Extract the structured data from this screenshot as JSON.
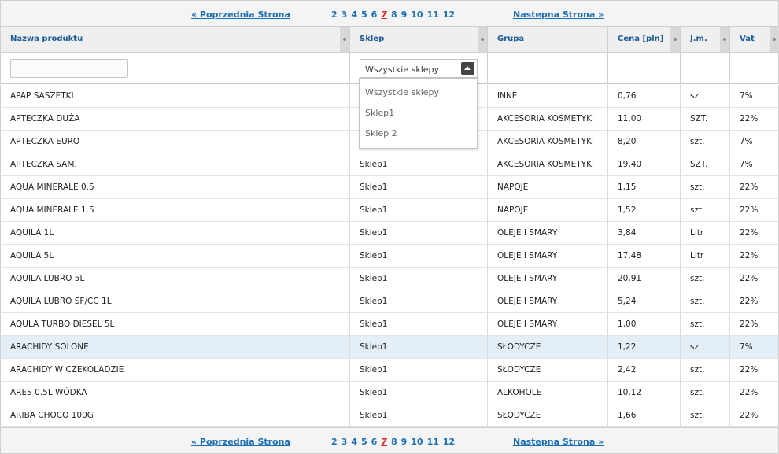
{
  "pager": {
    "prev_label": "« Poprzednia Strona",
    "next_label": "Nastepna Strona »",
    "pages": [
      "2",
      "3",
      "4",
      "5",
      "6",
      "7",
      "8",
      "9",
      "10",
      "11",
      "12"
    ],
    "current": "7"
  },
  "columns": [
    "Nazwa produktu",
    "Sklep",
    "Grupa",
    "Cena [pln]",
    "J.m.",
    "Vat"
  ],
  "filters": {
    "name_value": "",
    "shop_value": "Wszystkie sklepy",
    "shop_options": [
      "Wszystkie sklepy",
      "Sklep1",
      "Sklep 2"
    ]
  },
  "rows": [
    [
      "APAP SASZETKI",
      "",
      "INNE",
      "0,76",
      "szt.",
      "7%"
    ],
    [
      "APTECZKA DUŻA",
      "",
      "AKCESORIA KOSMETYKI",
      "11,00",
      "SZT.",
      "22%"
    ],
    [
      "APTECZKA EURO",
      "",
      "AKCESORIA KOSMETYKI",
      "8,20",
      "szt.",
      "7%"
    ],
    [
      "APTECZKA SAM.",
      "Sklep1",
      "AKCESORIA KOSMETYKI",
      "19,40",
      "SZT.",
      "7%"
    ],
    [
      "AQUA MINERALE 0.5",
      "Sklep1",
      "NAPOJE",
      "1,15",
      "szt.",
      "22%"
    ],
    [
      "AQUA MINERALE 1.5",
      "Sklep1",
      "NAPOJE",
      "1,52",
      "szt.",
      "22%"
    ],
    [
      "AQUILA 1L",
      "Sklep1",
      "OLEJE I SMARY",
      "3,84",
      "Litr",
      "22%"
    ],
    [
      "AQUILA 5L",
      "Sklep1",
      "OLEJE I SMARY",
      "17,48",
      "Litr",
      "22%"
    ],
    [
      "AQUILA LUBRO 5L",
      "Sklep1",
      "OLEJE I SMARY",
      "20,91",
      "szt.",
      "22%"
    ],
    [
      "AQUILA LUBRO SF/CC 1L",
      "Sklep1",
      "OLEJE I SMARY",
      "5,24",
      "szt.",
      "22%"
    ],
    [
      "AQULA TURBO DIESEL 5L",
      "Sklep1",
      "OLEJE I SMARY",
      "1,00",
      "szt.",
      "22%"
    ],
    [
      "ARACHIDY SOLONE",
      "Sklep1",
      "SŁODYCZE",
      "1,22",
      "szt.",
      "7%"
    ],
    [
      "ARACHIDY W CZEKOLADZIE",
      "Sklep1",
      "SŁODYCZE",
      "2,42",
      "szt.",
      "22%"
    ],
    [
      "ARES 0.5L WÓDKA",
      "Sklep1",
      "ALKOHOLE",
      "10,12",
      "szt.",
      "22%"
    ],
    [
      "ARIBA CHOCO 100G",
      "Sklep1",
      "SŁODYCZE",
      "1,66",
      "szt.",
      "22%"
    ]
  ],
  "highlight_row": "ARACHIDY SOLONE"
}
